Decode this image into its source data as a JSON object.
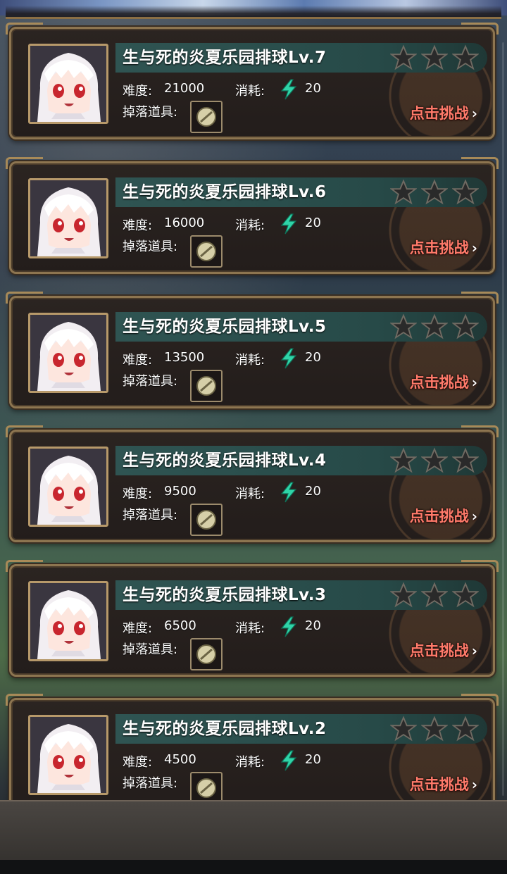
{
  "stages": [
    {
      "title": "生与死的炎夏乐园排球Lv.7",
      "difficulty": "21000",
      "cost": "20"
    },
    {
      "title": "生与死的炎夏乐园排球Lv.6",
      "difficulty": "16000",
      "cost": "20"
    },
    {
      "title": "生与死的炎夏乐园排球Lv.5",
      "difficulty": "13500",
      "cost": "20"
    },
    {
      "title": "生与死的炎夏乐园排球Lv.4",
      "difficulty": "9500",
      "cost": "20"
    },
    {
      "title": "生与死的炎夏乐园排球Lv.3",
      "difficulty": "6500",
      "cost": "20"
    },
    {
      "title": "生与死的炎夏乐园排球Lv.2",
      "difficulty": "4500",
      "cost": "20"
    }
  ],
  "labels": {
    "difficulty": "难度:",
    "cost": "消耗:",
    "drops": "掉落道具:",
    "challenge": "点击挑战"
  },
  "icons": {
    "star": "star-outline-icon",
    "energy": "lightning-bolt-icon",
    "item": "locked-item-icon",
    "chevron": "chevron-right-icon"
  },
  "colors": {
    "title_band": "#2f5452",
    "challenge_text": "#ff7a6a",
    "energy": "#2fd4a8",
    "frame": "#8d7550"
  }
}
